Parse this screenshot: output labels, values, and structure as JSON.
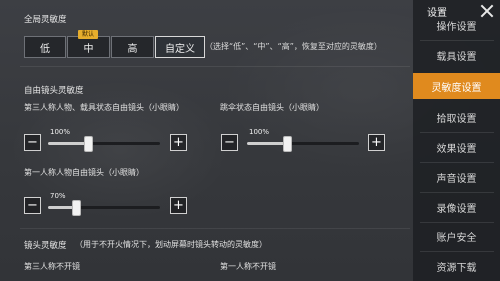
{
  "global": {
    "title": "全局灵敏度",
    "presets": [
      {
        "label": "低"
      },
      {
        "label": "中",
        "badge": "默认"
      },
      {
        "label": "高"
      },
      {
        "label": "自定义",
        "selected": true
      }
    ],
    "hint": "（选择“低”、“中”、“高”，恢复至对应的灵敏度）"
  },
  "free_camera": {
    "title": "自由镜头灵敏度",
    "items": [
      {
        "label": "第三人称人物、载具状态自由镜头（小眼睛）",
        "value_text": "100%",
        "value": 1.0
      },
      {
        "label": "跳伞状态自由镜头（小眼睛）",
        "value_text": "100%",
        "value": 1.0
      },
      {
        "label": "第一人称人物自由镜头（小眼睛）",
        "value_text": "70%",
        "value": 0.7
      }
    ],
    "minus": "−",
    "plus": "+"
  },
  "camera": {
    "title": "镜头灵敏度",
    "desc": "（用于不开火情况下，划动屏幕时镜头转动的灵敏度）",
    "tpp_label": "第三人称不开镜",
    "fpp_label": "第一人称不开镜"
  },
  "sidebar": {
    "title": "设置",
    "items": [
      {
        "label": "操作设置"
      },
      {
        "label": "载具设置"
      },
      {
        "label": "灵敏度设置",
        "active": true
      },
      {
        "label": "拾取设置"
      },
      {
        "label": "效果设置"
      },
      {
        "label": "声音设置"
      },
      {
        "label": "录像设置"
      },
      {
        "label": "账户安全"
      },
      {
        "label": "资源下载"
      }
    ]
  },
  "colors": {
    "accent": "#e08a1e",
    "badge": "#e6ad2c"
  },
  "icons": {
    "close": "close-icon",
    "minus": "minus-icon",
    "plus": "plus-icon"
  }
}
